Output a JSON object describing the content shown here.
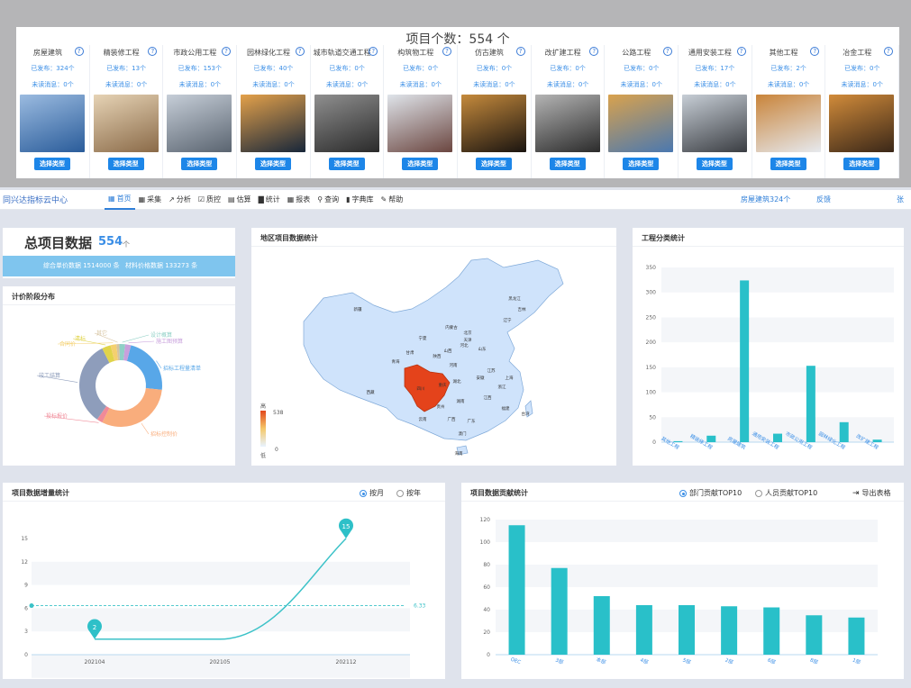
{
  "type_panel": {
    "title": "项目个数：554 个",
    "select_label": "选择类型",
    "types": [
      {
        "name": "房屋建筑",
        "published": "已发布：324个",
        "unread": "未读消息：0个",
        "colors": [
          "#2a5c9a",
          "#9bbbe0"
        ]
      },
      {
        "name": "精装修工程",
        "published": "已发布：13个",
        "unread": "未读消息：0个",
        "colors": [
          "#8a6a48",
          "#e6d3b5"
        ]
      },
      {
        "name": "市政公用工程",
        "published": "已发布：153个",
        "unread": "未读消息：0个",
        "colors": [
          "#5a6470",
          "#c6ced8"
        ]
      },
      {
        "name": "园林绿化工程",
        "published": "已发布：40个",
        "unread": "未读消息：0个",
        "colors": [
          "#17263a",
          "#e4a14a"
        ]
      },
      {
        "name": "城市轨道交通工程",
        "published": "已发布：0个",
        "unread": "未读消息：0个",
        "colors": [
          "#2a2a2a",
          "#8f8f8f"
        ]
      },
      {
        "name": "构筑物工程",
        "published": "已发布：0个",
        "unread": "未读消息：0个",
        "colors": [
          "#6b4640",
          "#dfe4ea"
        ]
      },
      {
        "name": "仿古建筑",
        "published": "已发布：0个",
        "unread": "未读消息：0个",
        "colors": [
          "#1a1410",
          "#c58a3c"
        ]
      },
      {
        "name": "改扩建工程",
        "published": "已发布：0个",
        "unread": "未读消息：0个",
        "colors": [
          "#2b2b2b",
          "#b4b4b4"
        ]
      },
      {
        "name": "公路工程",
        "published": "已发布：0个",
        "unread": "未读消息：0个",
        "colors": [
          "#4a78b0",
          "#d9a24d"
        ]
      },
      {
        "name": "通用安装工程",
        "published": "已发布：17个",
        "unread": "未读消息：0个",
        "colors": [
          "#3a3d42",
          "#c7ced6"
        ]
      },
      {
        "name": "其他工程",
        "published": "已发布：2个",
        "unread": "未读消息：0个",
        "colors": [
          "#e6e9ee",
          "#c9843a"
        ]
      },
      {
        "name": "冶金工程",
        "published": "已发布：0个",
        "unread": "未读消息：0个",
        "colors": [
          "#3a2718",
          "#d18b3a"
        ]
      }
    ]
  },
  "navbar": {
    "logo": "同兴达指标云中心",
    "menu": [
      {
        "label": "首页",
        "icon": "grid-icon",
        "glyph": "▦",
        "active": true
      },
      {
        "label": "采集",
        "icon": "grid-icon",
        "glyph": "▦",
        "active": false
      },
      {
        "label": "分析",
        "icon": "line-chart-icon",
        "glyph": "↗",
        "active": false
      },
      {
        "label": "质控",
        "icon": "check-icon",
        "glyph": "☑",
        "active": false
      },
      {
        "label": "估算",
        "icon": "calculator-icon",
        "glyph": "▤",
        "active": false
      },
      {
        "label": "统计",
        "icon": "bar-chart-icon",
        "glyph": "▇",
        "active": false
      },
      {
        "label": "报表",
        "icon": "table-icon",
        "glyph": "▦",
        "active": false
      },
      {
        "label": "查询",
        "icon": "search-icon",
        "glyph": "⚲",
        "active": false
      },
      {
        "label": "字典库",
        "icon": "book-icon",
        "glyph": "▮",
        "active": false
      },
      {
        "label": "帮助",
        "icon": "link-icon",
        "glyph": "✎",
        "active": false
      }
    ],
    "right_a": "房屋建筑324个",
    "right_b": "反馈",
    "right_c": "张"
  },
  "total": {
    "label": "总项目数据",
    "value": "554",
    "unit": "个",
    "strip_a": "综合单价数据  1514000 条",
    "strip_b": "材料价格数据  133273 条"
  },
  "donut": {
    "title": "计价阶段分布",
    "labels": [
      "其它",
      "清标",
      "合同价",
      "设计概算",
      "施工图预算",
      "招标工程量清单",
      "招标控制价",
      "投标报价",
      "竣工结算"
    ]
  },
  "map": {
    "title": "地区项目数据统计",
    "legend_high": "高",
    "legend_low": "低",
    "legend_max": "538",
    "legend_min": "0",
    "places": [
      "黑龙江",
      "吉林",
      "辽宁",
      "新疆",
      "内蒙古",
      "北京",
      "天津",
      "宁夏",
      "河北",
      "山西",
      "青海",
      "甘肃",
      "陕西",
      "山东",
      "河南",
      "江苏",
      "西藏",
      "四川",
      "湖北",
      "安徽",
      "上海",
      "重庆",
      "浙江",
      "湖南",
      "江西",
      "贵州",
      "福建",
      "云南",
      "广西",
      "广东",
      "台湾",
      "澳门",
      "海南"
    ]
  },
  "category": {
    "title": "工程分类统计",
    "y_ticks": [
      "350",
      "300",
      "250",
      "200",
      "150",
      "100",
      "50",
      "0"
    ]
  },
  "growth": {
    "title": "项目数据增量统计",
    "radio_a": "按月",
    "radio_b": "按年",
    "y_ticks": [
      "15",
      "12",
      "9",
      "6",
      "3",
      "0"
    ],
    "avg_label": "6.33",
    "pin_min": "2",
    "pin_max": "15"
  },
  "contrib": {
    "title": "项目数据贡献统计",
    "radio_a": "部门贡献TOP10",
    "radio_b": "人员贡献TOP10",
    "export": "导出表格",
    "y_ticks": [
      "120",
      "100",
      "80",
      "60",
      "40",
      "20",
      "0"
    ]
  },
  "chart_data": [
    {
      "type": "pie",
      "title": "计价阶段分布",
      "categories": [
        "招标工程量清单",
        "招标控制价",
        "投标报价",
        "竣工结算",
        "清标",
        "合同价",
        "其它",
        "设计概算",
        "施工图预算"
      ],
      "values": [
        20,
        27,
        2,
        29,
        3,
        2,
        1,
        2,
        2
      ],
      "colors": [
        "#58a7e8",
        "#f9ad7c",
        "#f08a98",
        "#8e9dbb",
        "#e0d44a",
        "#f4d06f",
        "#d6c3a0",
        "#8fd0c6",
        "#c8a0dc"
      ]
    },
    {
      "type": "bar",
      "title": "工程分类统计",
      "categories": [
        "其他工程",
        "精装修工程",
        "房屋建筑",
        "通用安装工程",
        "市政公用工程",
        "园林绿化工程",
        "改扩建工程"
      ],
      "values": [
        2,
        13,
        324,
        17,
        153,
        40,
        5
      ],
      "ylim": [
        0,
        350
      ]
    },
    {
      "type": "line",
      "title": "项目数据增量统计",
      "x": [
        "202104",
        "202105",
        "202112"
      ],
      "values": [
        2,
        2,
        15
      ],
      "average": 6.33,
      "ylim": [
        0,
        15
      ]
    },
    {
      "type": "bar",
      "title": "项目数据贡献统计",
      "categories": [
        "OEC",
        "3部",
        "本部",
        "4部",
        "5部",
        "2部",
        "6部",
        "8部",
        "1部"
      ],
      "values": [
        115,
        77,
        52,
        44,
        44,
        43,
        42,
        35,
        33
      ],
      "ylim": [
        0,
        120
      ]
    }
  ]
}
